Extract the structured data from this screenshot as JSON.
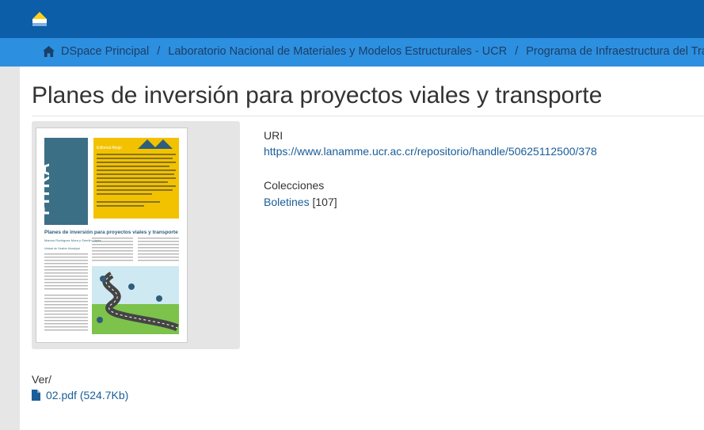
{
  "colors": {
    "topbar": "#0d5ea8",
    "breadcrumb_bar": "#2d8fe0",
    "link": "#1a5d99"
  },
  "breadcrumb": [
    "DSpace Principal",
    "Laboratorio Nacional de Materiales y Modelos Estructurales - UCR",
    "Programa de Infraestructura del Transporte"
  ],
  "breadcrumb_separator": "/",
  "page_title": "Planes de inversión para proyectos viales y transporte",
  "uri": {
    "label": "URI",
    "value": "https://www.lanamme.ucr.ac.cr/repositorio/handle/50625112500/378"
  },
  "collections": {
    "label": "Colecciones",
    "link": "Boletines",
    "count": "[107]"
  },
  "files": {
    "label": "Ver/",
    "name": "02.pdf (524.7Kb)"
  },
  "thumbnail": {
    "brand": "PITRA",
    "editorial_title": "Editorial Abajo",
    "article_title": "Planes de inversión para proyectos viales y transporte",
    "authors": "Marcos Rodríguez Mora y Sherlin López",
    "unit": "Unidad de Gestión Municipal"
  }
}
